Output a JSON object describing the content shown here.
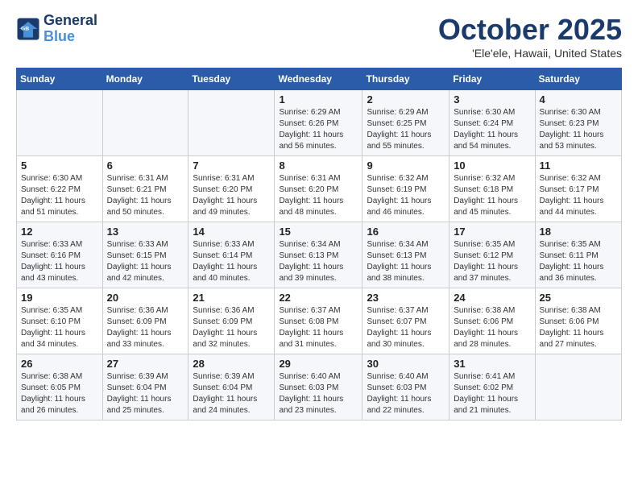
{
  "header": {
    "logo_line1": "General",
    "logo_line2": "Blue",
    "month": "October 2025",
    "location": "'Ele'ele, Hawaii, United States"
  },
  "days_of_week": [
    "Sunday",
    "Monday",
    "Tuesday",
    "Wednesday",
    "Thursday",
    "Friday",
    "Saturday"
  ],
  "weeks": [
    [
      {
        "day": "",
        "info": ""
      },
      {
        "day": "",
        "info": ""
      },
      {
        "day": "",
        "info": ""
      },
      {
        "day": "1",
        "info": "Sunrise: 6:29 AM\nSunset: 6:26 PM\nDaylight: 11 hours and 56 minutes."
      },
      {
        "day": "2",
        "info": "Sunrise: 6:29 AM\nSunset: 6:25 PM\nDaylight: 11 hours and 55 minutes."
      },
      {
        "day": "3",
        "info": "Sunrise: 6:30 AM\nSunset: 6:24 PM\nDaylight: 11 hours and 54 minutes."
      },
      {
        "day": "4",
        "info": "Sunrise: 6:30 AM\nSunset: 6:23 PM\nDaylight: 11 hours and 53 minutes."
      }
    ],
    [
      {
        "day": "5",
        "info": "Sunrise: 6:30 AM\nSunset: 6:22 PM\nDaylight: 11 hours and 51 minutes."
      },
      {
        "day": "6",
        "info": "Sunrise: 6:31 AM\nSunset: 6:21 PM\nDaylight: 11 hours and 50 minutes."
      },
      {
        "day": "7",
        "info": "Sunrise: 6:31 AM\nSunset: 6:20 PM\nDaylight: 11 hours and 49 minutes."
      },
      {
        "day": "8",
        "info": "Sunrise: 6:31 AM\nSunset: 6:20 PM\nDaylight: 11 hours and 48 minutes."
      },
      {
        "day": "9",
        "info": "Sunrise: 6:32 AM\nSunset: 6:19 PM\nDaylight: 11 hours and 46 minutes."
      },
      {
        "day": "10",
        "info": "Sunrise: 6:32 AM\nSunset: 6:18 PM\nDaylight: 11 hours and 45 minutes."
      },
      {
        "day": "11",
        "info": "Sunrise: 6:32 AM\nSunset: 6:17 PM\nDaylight: 11 hours and 44 minutes."
      }
    ],
    [
      {
        "day": "12",
        "info": "Sunrise: 6:33 AM\nSunset: 6:16 PM\nDaylight: 11 hours and 43 minutes."
      },
      {
        "day": "13",
        "info": "Sunrise: 6:33 AM\nSunset: 6:15 PM\nDaylight: 11 hours and 42 minutes."
      },
      {
        "day": "14",
        "info": "Sunrise: 6:33 AM\nSunset: 6:14 PM\nDaylight: 11 hours and 40 minutes."
      },
      {
        "day": "15",
        "info": "Sunrise: 6:34 AM\nSunset: 6:13 PM\nDaylight: 11 hours and 39 minutes."
      },
      {
        "day": "16",
        "info": "Sunrise: 6:34 AM\nSunset: 6:13 PM\nDaylight: 11 hours and 38 minutes."
      },
      {
        "day": "17",
        "info": "Sunrise: 6:35 AM\nSunset: 6:12 PM\nDaylight: 11 hours and 37 minutes."
      },
      {
        "day": "18",
        "info": "Sunrise: 6:35 AM\nSunset: 6:11 PM\nDaylight: 11 hours and 36 minutes."
      }
    ],
    [
      {
        "day": "19",
        "info": "Sunrise: 6:35 AM\nSunset: 6:10 PM\nDaylight: 11 hours and 34 minutes."
      },
      {
        "day": "20",
        "info": "Sunrise: 6:36 AM\nSunset: 6:09 PM\nDaylight: 11 hours and 33 minutes."
      },
      {
        "day": "21",
        "info": "Sunrise: 6:36 AM\nSunset: 6:09 PM\nDaylight: 11 hours and 32 minutes."
      },
      {
        "day": "22",
        "info": "Sunrise: 6:37 AM\nSunset: 6:08 PM\nDaylight: 11 hours and 31 minutes."
      },
      {
        "day": "23",
        "info": "Sunrise: 6:37 AM\nSunset: 6:07 PM\nDaylight: 11 hours and 30 minutes."
      },
      {
        "day": "24",
        "info": "Sunrise: 6:38 AM\nSunset: 6:06 PM\nDaylight: 11 hours and 28 minutes."
      },
      {
        "day": "25",
        "info": "Sunrise: 6:38 AM\nSunset: 6:06 PM\nDaylight: 11 hours and 27 minutes."
      }
    ],
    [
      {
        "day": "26",
        "info": "Sunrise: 6:38 AM\nSunset: 6:05 PM\nDaylight: 11 hours and 26 minutes."
      },
      {
        "day": "27",
        "info": "Sunrise: 6:39 AM\nSunset: 6:04 PM\nDaylight: 11 hours and 25 minutes."
      },
      {
        "day": "28",
        "info": "Sunrise: 6:39 AM\nSunset: 6:04 PM\nDaylight: 11 hours and 24 minutes."
      },
      {
        "day": "29",
        "info": "Sunrise: 6:40 AM\nSunset: 6:03 PM\nDaylight: 11 hours and 23 minutes."
      },
      {
        "day": "30",
        "info": "Sunrise: 6:40 AM\nSunset: 6:03 PM\nDaylight: 11 hours and 22 minutes."
      },
      {
        "day": "31",
        "info": "Sunrise: 6:41 AM\nSunset: 6:02 PM\nDaylight: 11 hours and 21 minutes."
      },
      {
        "day": "",
        "info": ""
      }
    ]
  ]
}
